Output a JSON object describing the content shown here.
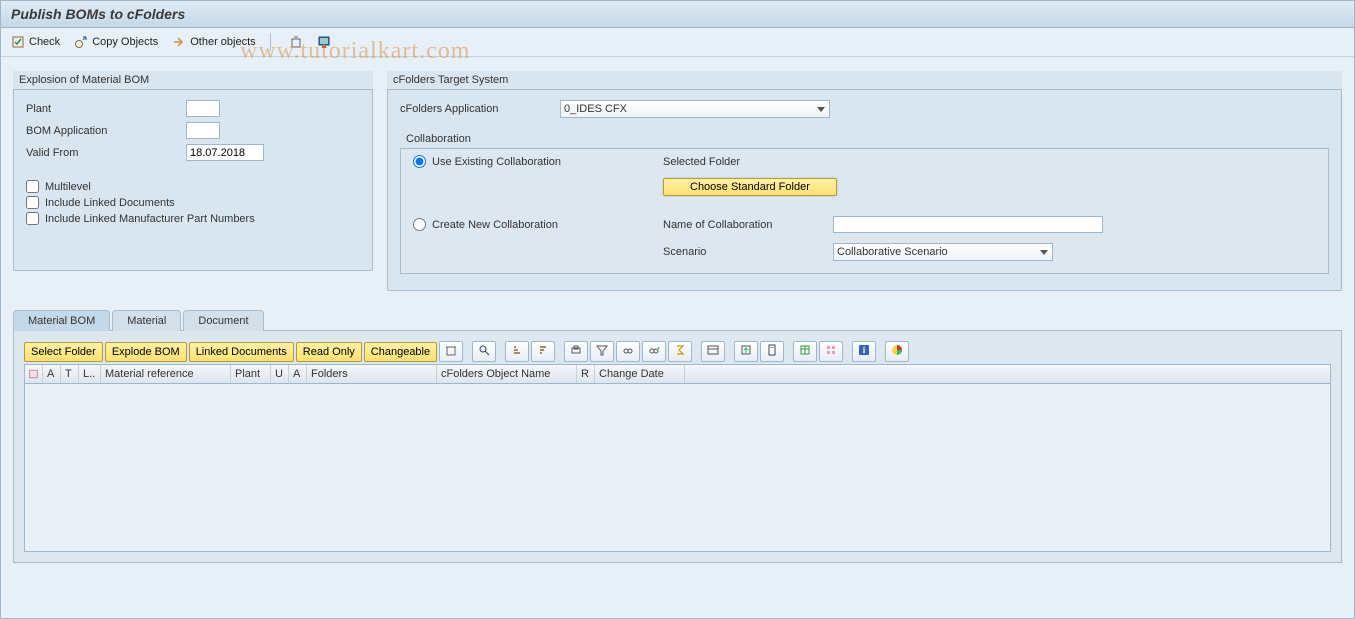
{
  "title": "Publish BOMs to cFolders",
  "toolbar": {
    "check": "Check",
    "copy_objects": "Copy Objects",
    "other_objects": "Other objects"
  },
  "explosion": {
    "title": "Explosion of Material BOM",
    "plant_label": "Plant",
    "plant_value": "",
    "bom_app_label": "BOM Application",
    "bom_app_value": "",
    "valid_from_label": "Valid From",
    "valid_from_value": "18.07.2018",
    "multilevel_label": "Multilevel",
    "include_docs_label": "Include Linked Documents",
    "include_mpn_label": "Include Linked Manufacturer Part Numbers"
  },
  "target": {
    "title": "cFolders Target System",
    "app_label": "cFolders Application",
    "app_value": "0_IDES CFX"
  },
  "collab": {
    "title": "Collaboration",
    "use_existing_label": "Use Existing Collaboration",
    "selected_folder_label": "Selected Folder",
    "choose_btn": "Choose Standard Folder",
    "create_new_label": "Create New Collaboration",
    "name_label": "Name of Collaboration",
    "name_value": "",
    "scenario_label": "Scenario",
    "scenario_value": "Collaborative Scenario"
  },
  "tabs": {
    "material_bom": "Material BOM",
    "material": "Material",
    "document": "Document"
  },
  "alv": {
    "select_folder": "Select Folder",
    "explode_bom": "Explode BOM",
    "linked_docs": "Linked Documents",
    "read_only": "Read Only",
    "changeable": "Changeable",
    "cols": {
      "a1": "A",
      "t": "T",
      "l": "L..",
      "matref": "Material reference",
      "plant": "Plant",
      "u": "U",
      "a2": "A",
      "folders": "Folders",
      "objname": "cFolders Object Name",
      "r": "R",
      "chdate": "Change Date"
    }
  },
  "watermark": "www.tutorialkart.com"
}
